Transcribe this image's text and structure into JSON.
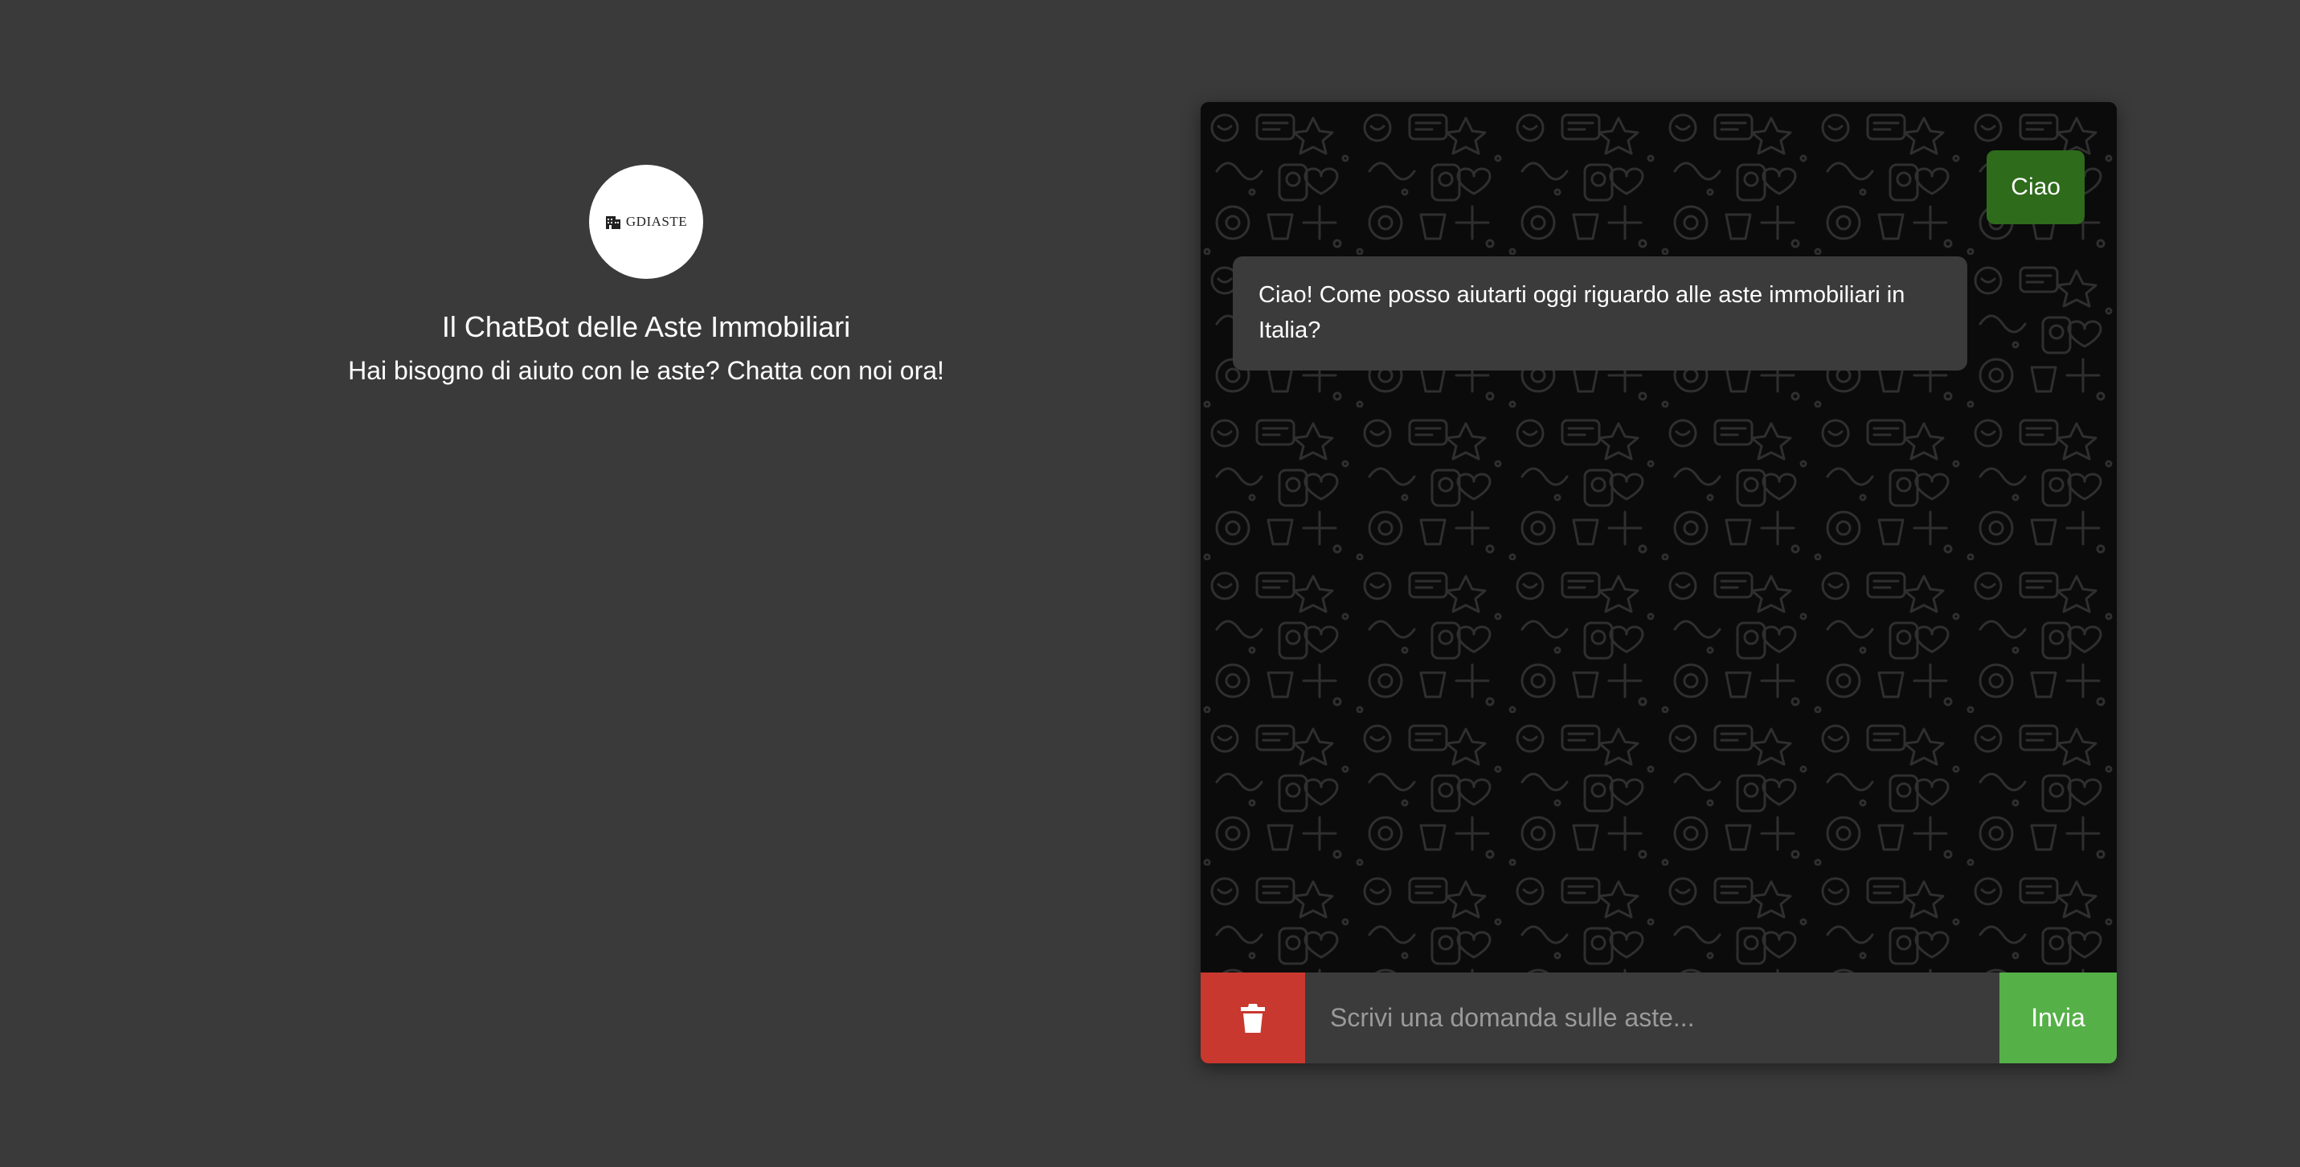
{
  "intro": {
    "logo_text": "GDIASTE",
    "title": "Il ChatBot delle Aste Immobiliari",
    "subtitle": "Hai bisogno di aiuto con le aste? Chatta con noi ora!"
  },
  "chat": {
    "messages": [
      {
        "role": "user",
        "text": "Ciao"
      },
      {
        "role": "bot",
        "text": "Ciao! Come posso aiutarti oggi riguardo alle aste immobiliari in Italia?"
      }
    ],
    "input": {
      "value": "",
      "placeholder": "Scrivi una domanda sulle aste..."
    },
    "send_label": "Invia",
    "clear_icon": "trash-icon"
  },
  "colors": {
    "page_background": "#3a3a3a",
    "chat_background": "#0b0b0b",
    "user_bubble": "#2e6b1b",
    "bot_bubble": "#3b3b3b",
    "clear_button": "#c9382e",
    "send_button": "#55b048"
  }
}
